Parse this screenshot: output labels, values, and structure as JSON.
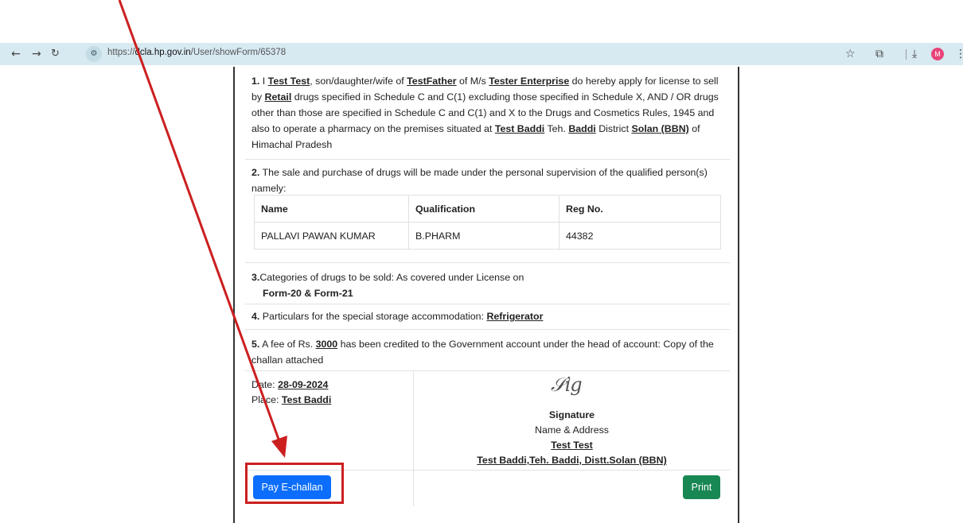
{
  "browser": {
    "url_prefix": "https://",
    "url_domain": "dcla.hp.gov.in",
    "url_path": "/User/showForm/65378",
    "nav_icons": [
      "back-icon",
      "forward-icon",
      "reload-icon"
    ],
    "right_icons": [
      "star-icon",
      "extensions-icon",
      "download-icon",
      "menu-icon"
    ],
    "profile_initial": "M"
  },
  "form": {
    "section1": {
      "num": "1.",
      "t1": " I ",
      "applicant": "Test Test",
      "t2": ", son/daughter/wife of ",
      "father": "TestFather",
      "t3": " of M/s ",
      "firm": "Tester Enterprise",
      "t4": " do hereby apply for license to sell by ",
      "sale_type": "Retail",
      "t5": " drugs specified in Schedule C and C(1) excluding those specified in Schedule X, AND / OR drugs other than those are specified in Schedule C and C(1) and X to the Drugs and Cosmetics Rules, 1945 and also to operate a pharmacy on the premises situated at ",
      "premises": "Test Baddi",
      "t6": " Teh. ",
      "tehsil": "Baddi",
      "t7": " District ",
      "district": "Solan (BBN)",
      "t8": " of Himachal Pradesh"
    },
    "section2": {
      "num": "2.",
      "text": " The sale and purchase of drugs will be made under the personal supervision of the qualified person(s) namely:",
      "headers": [
        "Name",
        "Qualification",
        "Reg No."
      ],
      "rows": [
        [
          "PALLAVI PAWAN KUMAR",
          "B.PHARM",
          "44382"
        ]
      ]
    },
    "section3": {
      "num": "3.",
      "text": "Categories of drugs to be sold: As covered under License on",
      "forms": "Form-20 & Form-21"
    },
    "section4": {
      "num": "4.",
      "text": " Particulars for the special storage accommodation: ",
      "storage": "Refrigerator"
    },
    "section5": {
      "num": "5.",
      "t1": " A fee of Rs. ",
      "fee": "3000",
      "t2": " has been credited to the Government account under the head of account: Copy of the challan attached"
    },
    "date_label": "Date: ",
    "date": "28-09-2024",
    "place_label": "Place: ",
    "place": "Test Baddi",
    "signature_label": "Signature",
    "name_address_label": "Name & Address",
    "signer_name": "Test Test",
    "signer_address": "Test Baddi,Teh. Baddi, Distt.Solan (BBN)",
    "pay_button": "Pay E-challan",
    "print_button": "Print"
  },
  "annotation": {
    "color": "#cc1f1f"
  }
}
